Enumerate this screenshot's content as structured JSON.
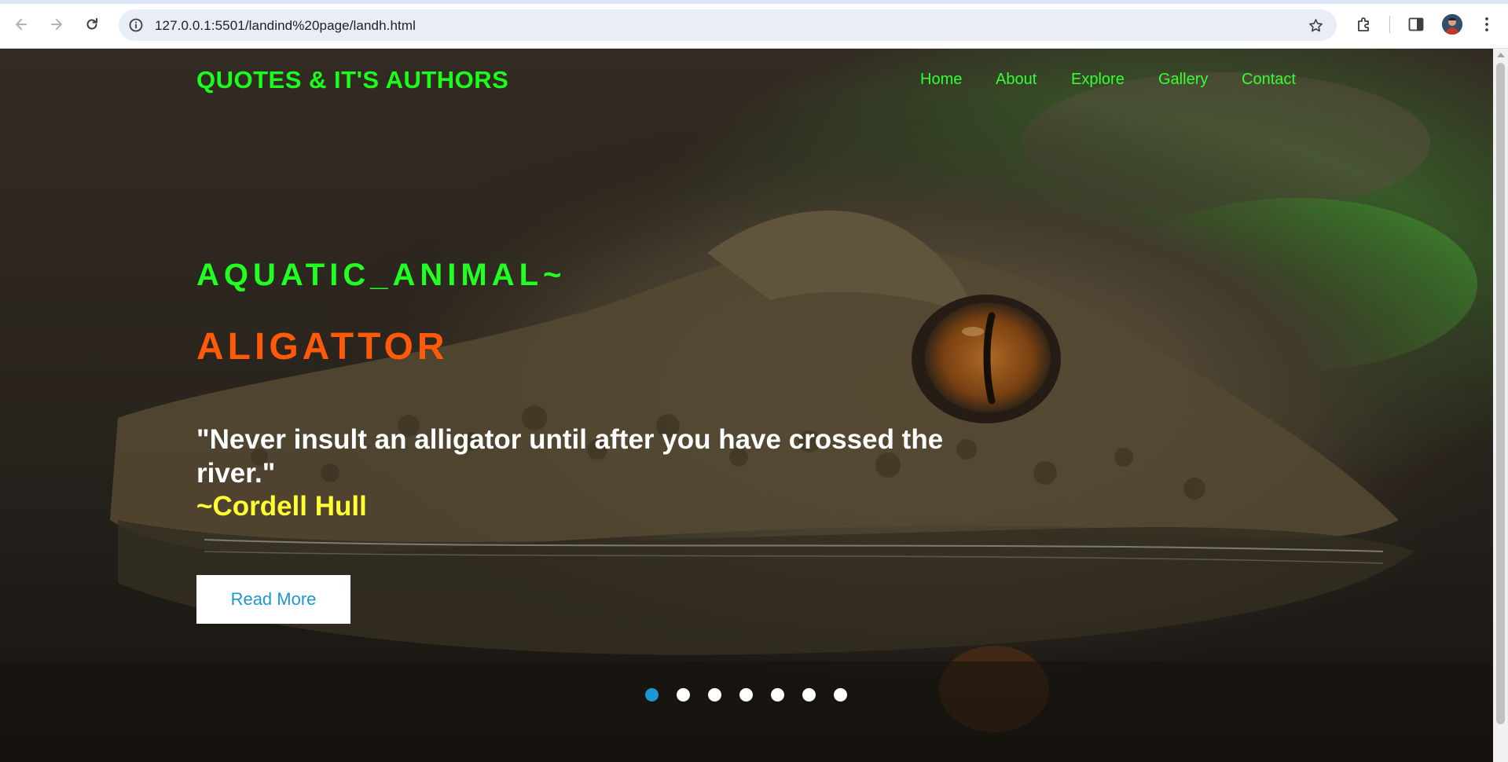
{
  "browser": {
    "url": "127.0.0.1:5501/landind%20page/landh.html"
  },
  "site": {
    "logo": "QUOTES & IT'S AUTHORS",
    "nav": [
      {
        "label": "Home"
      },
      {
        "label": "About"
      },
      {
        "label": "Explore"
      },
      {
        "label": "Gallery"
      },
      {
        "label": "Contact"
      }
    ]
  },
  "hero": {
    "subtitle": "AQUATIC_ANIMAL~",
    "title": "ALIGATTOR",
    "quote": "\"Never insult an alligator until after you have crossed the river.\"",
    "author": "~Cordell Hull",
    "button_label": "Read More",
    "slides_total": 7,
    "active_slide": 1
  },
  "colors": {
    "logo": "#1aff1a",
    "nav": "#33ff33",
    "subtitle": "#22ff22",
    "title": "#ff5a0a",
    "quote": "#ffffff",
    "author": "#ffff33",
    "button_text": "#1e95d4",
    "active_dot": "#1e95d4"
  },
  "icons": {
    "back": "arrow-left-icon",
    "forward": "arrow-right-icon",
    "reload": "reload-icon",
    "site_info": "info-icon",
    "bookmark": "star-icon",
    "extensions": "puzzle-icon",
    "side_panel": "side-panel-icon",
    "menu": "kebab-menu-icon"
  }
}
